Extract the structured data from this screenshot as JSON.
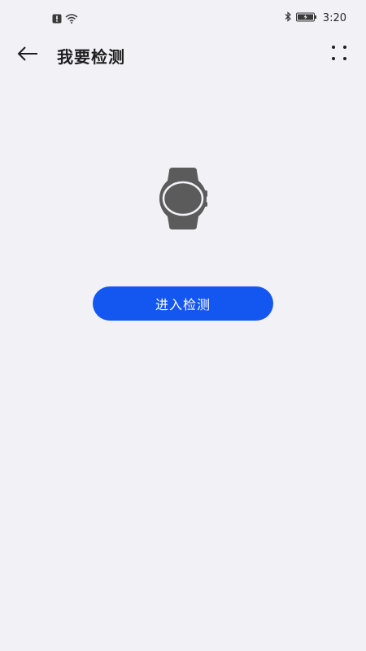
{
  "status_bar": {
    "time": "3:20",
    "icons": [
      "notification-alert-icon",
      "wifi-icon",
      "bluetooth-icon",
      "battery-icon"
    ]
  },
  "header": {
    "title": "我要检测",
    "back_icon": "arrow-left-icon",
    "more_icon": "more-dots-icon"
  },
  "device": {
    "icon": "smartwatch-icon"
  },
  "action": {
    "enter_label": "进入检测"
  },
  "colors": {
    "background": "#f1f1f6",
    "accent": "#1457f0",
    "device": "#5b5b5b"
  }
}
